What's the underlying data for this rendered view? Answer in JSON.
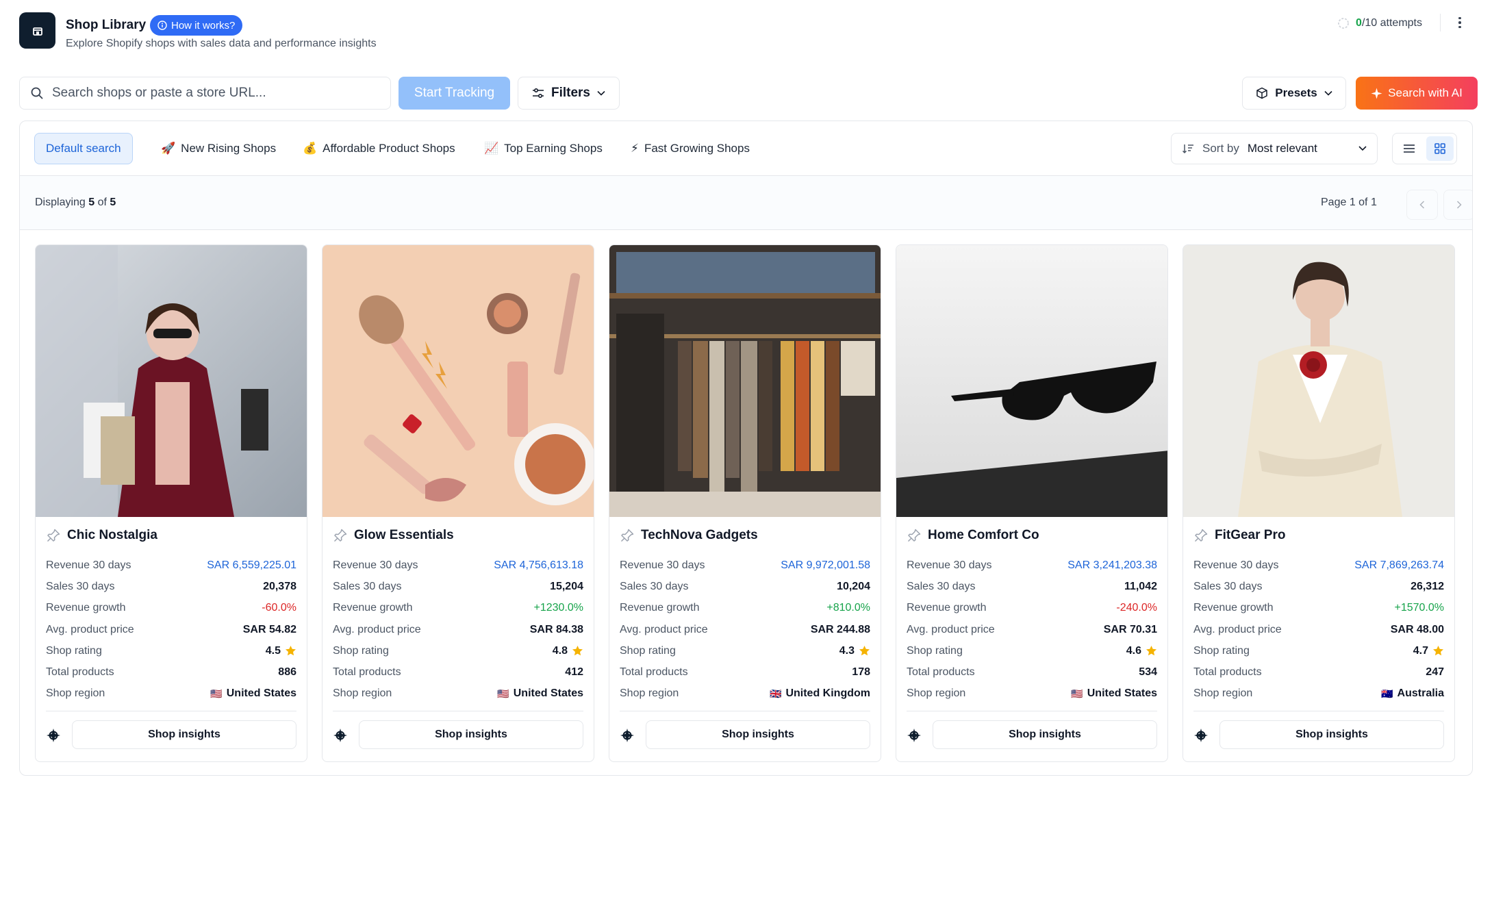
{
  "header": {
    "title": "Shop Library",
    "how_it_works": "How it works?",
    "subtitle": "Explore Shopify shops with sales data and performance insights",
    "attempts_used": "0",
    "attempts_rest": "/10 attempts"
  },
  "toolbar": {
    "search_placeholder": "Search shops or paste a store URL...",
    "start_tracking": "Start Tracking",
    "filters": "Filters",
    "presets": "Presets",
    "search_ai": "Search with AI"
  },
  "tabs": [
    {
      "label": "Default search",
      "emoji": ""
    },
    {
      "label": "New Rising Shops",
      "emoji": "🚀"
    },
    {
      "label": "Affordable Product Shops",
      "emoji": "💰"
    },
    {
      "label": "Top Earning Shops",
      "emoji": "📈"
    },
    {
      "label": "Fast Growing Shops",
      "emoji": "⚡"
    }
  ],
  "sort": {
    "label": "Sort by",
    "value": "Most relevant"
  },
  "listing": {
    "displaying_prefix": "Displaying",
    "shown": "5",
    "of": "of",
    "total": "5",
    "page_info": "Page 1 of 1"
  },
  "labels": {
    "revenue": "Revenue 30 days",
    "sales": "Sales 30 days",
    "growth": "Revenue growth",
    "avg_price": "Avg. product price",
    "rating": "Shop rating",
    "products": "Total products",
    "region": "Shop region",
    "insights": "Shop insights"
  },
  "shops": [
    {
      "name": "Chic Nostalgia",
      "revenue": "SAR 6,559,225.01",
      "sales": "20,378",
      "growth": "-60.0%",
      "avg_price": "SAR 54.82",
      "rating": "4.5",
      "products": "886",
      "flag": "🇺🇸",
      "region": "United States"
    },
    {
      "name": "Glow Essentials",
      "revenue": "SAR 4,756,613.18",
      "sales": "15,204",
      "growth": "+1230.0%",
      "avg_price": "SAR 84.38",
      "rating": "4.8",
      "products": "412",
      "flag": "🇺🇸",
      "region": "United States"
    },
    {
      "name": "TechNova Gadgets",
      "revenue": "SAR 9,972,001.58",
      "sales": "10,204",
      "growth": "+810.0%",
      "avg_price": "SAR 244.88",
      "rating": "4.3",
      "products": "178",
      "flag": "🇬🇧",
      "region": "United Kingdom"
    },
    {
      "name": "Home Comfort Co",
      "revenue": "SAR 3,241,203.38",
      "sales": "11,042",
      "growth": "-240.0%",
      "avg_price": "SAR 70.31",
      "rating": "4.6",
      "products": "534",
      "flag": "🇺🇸",
      "region": "United States"
    },
    {
      "name": "FitGear Pro",
      "revenue": "SAR 7,869,263.74",
      "sales": "26,312",
      "growth": "+1570.0%",
      "avg_price": "SAR 48.00",
      "rating": "4.7",
      "products": "247",
      "flag": "🇦🇺",
      "region": "Australia"
    }
  ],
  "colors": {
    "accent": "#2f6bf5",
    "positive": "#16a34a",
    "negative": "#dc2626",
    "ai_gradient_start": "#f97316",
    "ai_gradient_end": "#f43f5e",
    "star": "#f5b301"
  },
  "icons": {
    "logo": "shop-icon",
    "search": "search-icon",
    "filters": "sliders-icon",
    "presets": "box-icon",
    "ai": "sparkle-icon",
    "pin": "pin-icon",
    "star": "star-icon",
    "brand": "compass-icon",
    "list_view": "list-icon",
    "grid_view": "grid-icon"
  }
}
